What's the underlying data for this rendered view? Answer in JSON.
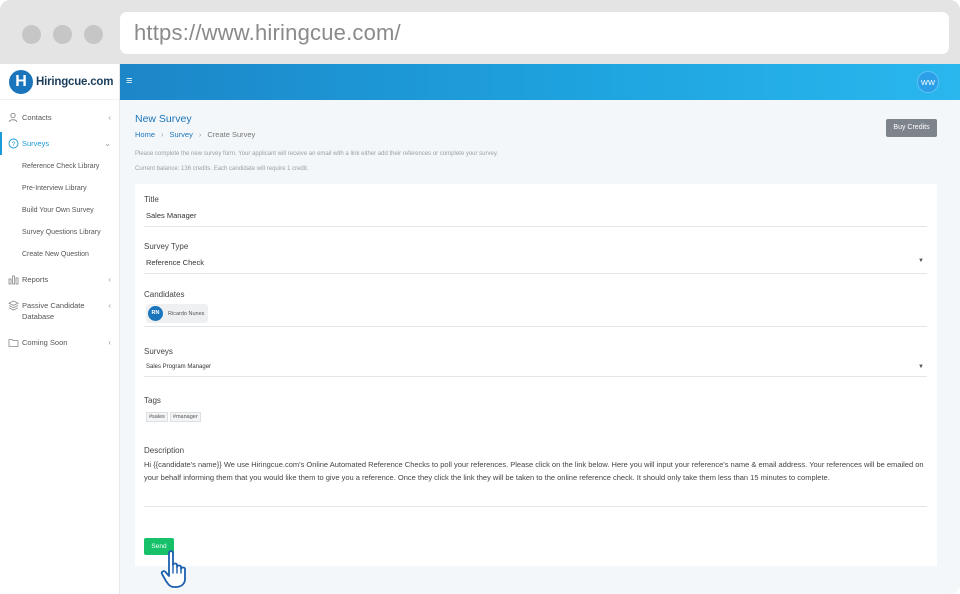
{
  "browser": {
    "url": "https://www.hiringcue.com/"
  },
  "logo": {
    "mark": "H",
    "text": "Hiringcue.com"
  },
  "sidebar": {
    "items": [
      {
        "label": "Contacts",
        "icon": "contacts-icon",
        "chevron": "‹"
      },
      {
        "label": "Surveys",
        "icon": "surveys-icon",
        "chevron": "⌄",
        "active": true
      },
      {
        "label": "Reports",
        "icon": "reports-icon",
        "chevron": "‹"
      },
      {
        "label": "Passive Candidate Database",
        "icon": "database-icon",
        "chevron": "‹"
      },
      {
        "label": "Coming Soon",
        "icon": "folder-icon",
        "chevron": "‹"
      }
    ],
    "subitems": [
      "Reference Check Library",
      "Pre-Interview Library",
      "Build Your Own Survey",
      "Survey Questions Library",
      "Create New Question"
    ]
  },
  "topbar": {
    "menu_icon": "≡",
    "user_initials": "WW"
  },
  "page": {
    "title": "New Survey",
    "breadcrumb": [
      "Home",
      "Survey",
      "Create Survey"
    ],
    "buy_credits": "Buy Credits",
    "info_line1": "Please complete the new survey form. Your applicant will receive an email with a link either add their references or complete your survey.",
    "info_line2": "Current balance: 136 credits. Each candidate will require 1 credit."
  },
  "form": {
    "title_label": "Title",
    "title_value": "Sales Manager",
    "type_label": "Survey Type",
    "type_value": "Reference Check",
    "candidates_label": "Candidates",
    "candidate": {
      "initials": "RN",
      "name": "Ricardo Nunes"
    },
    "surveys_label": "Surveys",
    "surveys_value": "Sales Program Manager",
    "tags_label": "Tags",
    "tags": [
      "#sales",
      "#manager"
    ],
    "description_label": "Description",
    "description": "Hi {{candidate's name}} We use Hiringcue.com's Online Automated Reference Checks to poll your references. Please click on the link below. Here you will input your reference's name & email address. Your references will be emailed on your behalf informing them that you would like them to give you a reference. Once they click the link they will be taken to the online reference check. It should only take them less than 15 minutes to complete.",
    "send_label": "Send"
  },
  "colors": {
    "brand": "#1b75bc",
    "topbar": "#1ea3df",
    "send": "#16c16a",
    "buy_credits": "#7d848b"
  }
}
